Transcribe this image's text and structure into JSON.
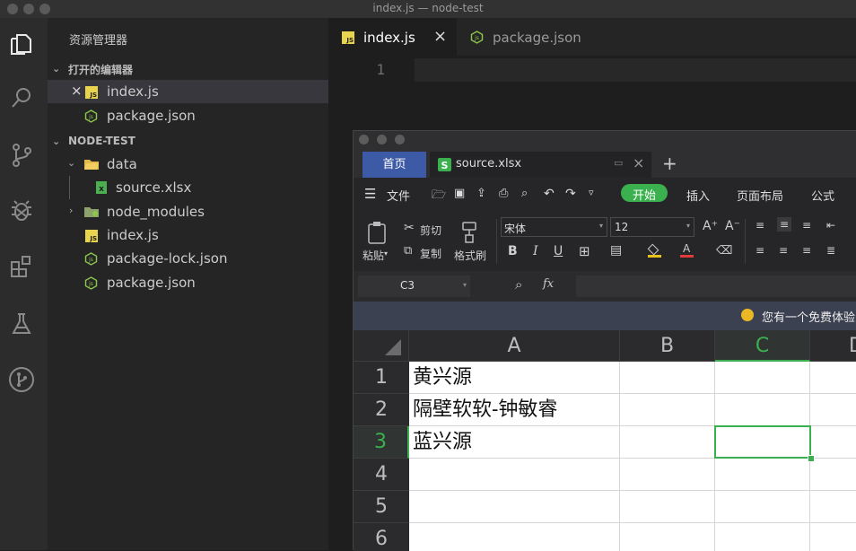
{
  "window": {
    "title": "index.js — node-test"
  },
  "sidebar": {
    "title": "资源管理器",
    "open_editors": {
      "label": "打开的编辑器",
      "items": [
        {
          "name": "index.js"
        },
        {
          "name": "package.json"
        }
      ]
    },
    "project": {
      "label": "NODE-TEST",
      "items": [
        {
          "name": "data"
        },
        {
          "name": "source.xlsx"
        },
        {
          "name": "node_modules"
        },
        {
          "name": "index.js"
        },
        {
          "name": "package-lock.json"
        },
        {
          "name": "package.json"
        }
      ]
    }
  },
  "editor": {
    "tabs": [
      {
        "label": "index.js",
        "active": true
      },
      {
        "label": "package.json",
        "active": false
      }
    ],
    "line_numbers": [
      "1"
    ]
  },
  "wps": {
    "tabs": {
      "home": "首页",
      "file": "source.xlsx"
    },
    "menu": {
      "file": "文件",
      "start": "开始",
      "insert": "插入",
      "page_layout": "页面布局",
      "formula": "公式"
    },
    "toolbar": {
      "paste": "粘贴",
      "cut": "剪切",
      "copy": "复制",
      "format_painter": "格式刷",
      "font_name": "宋体",
      "font_size": "12",
      "bold": "B",
      "italic": "I",
      "underline": "U",
      "grow_font": "A⁺",
      "shrink_font": "A⁻"
    },
    "formula_bar": {
      "cell_ref": "C3",
      "fx": "fx",
      "value": ""
    },
    "notice": "您有一个免费体验",
    "grid": {
      "columns": [
        "A",
        "B",
        "C",
        "D"
      ],
      "rows": [
        "1",
        "2",
        "3",
        "4",
        "5",
        "6"
      ],
      "cells": {
        "A1": "黄兴源",
        "A2": "隔壁软软-钟敏睿",
        "A3": "蓝兴源"
      },
      "selected": "C3"
    },
    "colors": {
      "accent_green": "#3bb04f",
      "tab_blue": "#3d5aa7"
    }
  }
}
